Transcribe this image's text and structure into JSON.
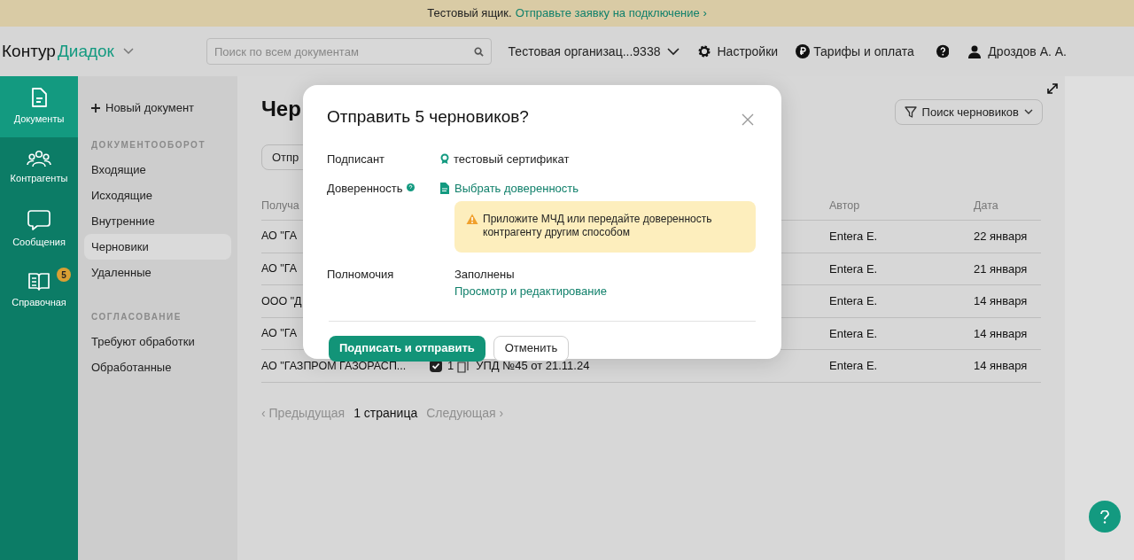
{
  "banner": {
    "text": "Тестовый ящик.",
    "link": "Отправьте заявку на подключение ›"
  },
  "header": {
    "logo_dark": "Контур",
    "logo_accent": "Диадок",
    "search": {
      "placeholder": "Поиск по всем документам"
    },
    "organization": "Тестовая организац...9338",
    "settings": "Настройки",
    "tariffs": "Тарифы и оплата",
    "user": "Дроздов А. А."
  },
  "rail": [
    {
      "label": "Документы",
      "selected": true
    },
    {
      "label": "Контрагенты",
      "selected": false
    },
    {
      "label": "Сообщения",
      "selected": false
    },
    {
      "label": "Справочная",
      "selected": false,
      "badge": "5"
    }
  ],
  "nav": {
    "new_document": "Новый документ",
    "sections": [
      {
        "title": "ДОКУМЕНТООБОРОТ",
        "items": [
          {
            "label": "Входящие",
            "selected": false
          },
          {
            "label": "Исходящие",
            "selected": false
          },
          {
            "label": "Внутренние",
            "selected": false
          },
          {
            "label": "Черновики",
            "selected": true
          },
          {
            "label": "Удаленные",
            "selected": false
          }
        ]
      },
      {
        "title": "СОГЛАСОВАНИЕ",
        "items": [
          {
            "label": "Требуют обработки",
            "selected": false
          },
          {
            "label": "Обработанные",
            "selected": false
          }
        ]
      }
    ]
  },
  "main": {
    "title": "Чер",
    "action_button": "Отпр",
    "filter_button": "Поиск черновиков",
    "table": {
      "columns": [
        {
          "label": "Получа"
        },
        {
          "label": "Автор"
        },
        {
          "label": "Дата"
        }
      ],
      "rows": [
        {
          "recipient": "АО \"ГА",
          "author": "Entera E.",
          "date": "22 января"
        },
        {
          "recipient": "АО \"ГА",
          "author": "Entera E.",
          "date": "21 января"
        },
        {
          "recipient": "ООО \"Д",
          "author": "Entera E.",
          "date": "14 января"
        },
        {
          "recipient": "АО \"ГА",
          "author": "Entera E.",
          "date": "14 января"
        },
        {
          "recipient": "АО \"ГАЗПРОМ ГАЗОРАСП...",
          "checked": true,
          "count": "1",
          "document": "УПД №45 от 21.11.24",
          "author": "Entera E.",
          "date": "14 января"
        }
      ]
    },
    "pagination": {
      "previous": "‹ Предыдущая",
      "current": "1 страница",
      "next": "Следующая ›"
    }
  },
  "dialog": {
    "title": "Отправить 5 черновиков?",
    "signer": {
      "label": "Подписант",
      "value": "тестовый сертификат"
    },
    "power_of_attorney": {
      "label": "Доверенность",
      "link": "Выбрать доверенность",
      "warning": "Приложите МЧД или передайте доверенность контрагенту другим способом"
    },
    "authority": {
      "label": "Полномочия",
      "value": "Заполнены",
      "link": "Просмотр и редактирование"
    },
    "buttons": [
      {
        "label": "Подписать и отправить",
        "kind": "primary"
      },
      {
        "label": "Отменить",
        "kind": "secondary"
      }
    ]
  }
}
